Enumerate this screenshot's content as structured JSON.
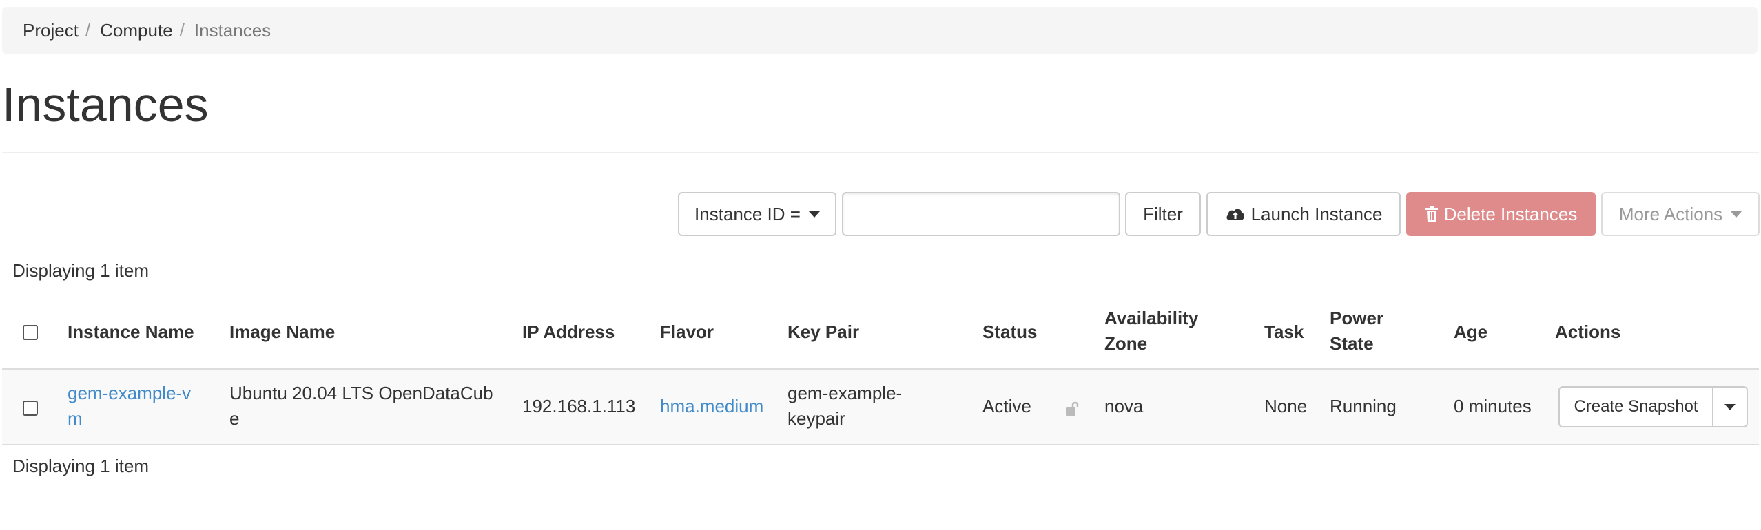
{
  "breadcrumb": {
    "items": [
      "Project",
      "Compute",
      "Instances"
    ]
  },
  "page": {
    "title": "Instances"
  },
  "toolbar": {
    "filter_select": "Instance ID =",
    "filter_input_value": "",
    "filter_button": "Filter",
    "launch_button": "Launch Instance",
    "delete_button": "Delete Instances",
    "more_actions": "More Actions"
  },
  "table": {
    "display_count": "Displaying 1 item",
    "headers": {
      "instance_name": "Instance Name",
      "image_name": "Image Name",
      "ip_address": "IP Address",
      "flavor": "Flavor",
      "key_pair": "Key Pair",
      "status": "Status",
      "availability_zone_1": "Availability",
      "availability_zone_2": "Zone",
      "task": "Task",
      "power_state_1": "Power",
      "power_state_2": "State",
      "age": "Age",
      "actions": "Actions"
    },
    "rows": [
      {
        "instance_name_1": "gem-example-v",
        "instance_name_2": "m",
        "image_name_1": "Ubuntu 20.04 LTS OpenDataCub",
        "image_name_2": "e",
        "ip_address": "192.168.1.113",
        "flavor": "hma.medium",
        "key_pair_1": "gem-example-",
        "key_pair_2": "keypair",
        "status": "Active",
        "availability_zone": "nova",
        "task": "None",
        "power_state": "Running",
        "age": "0 minutes",
        "action": "Create Snapshot"
      }
    ]
  },
  "colors": {
    "link": "#428bca",
    "danger_button": "#df8b8b",
    "breadcrumb_bg": "#f5f5f5"
  },
  "icons": {
    "launch": "cloud-upload-icon",
    "delete": "trash-icon",
    "status_lock": "unlocked-icon"
  }
}
